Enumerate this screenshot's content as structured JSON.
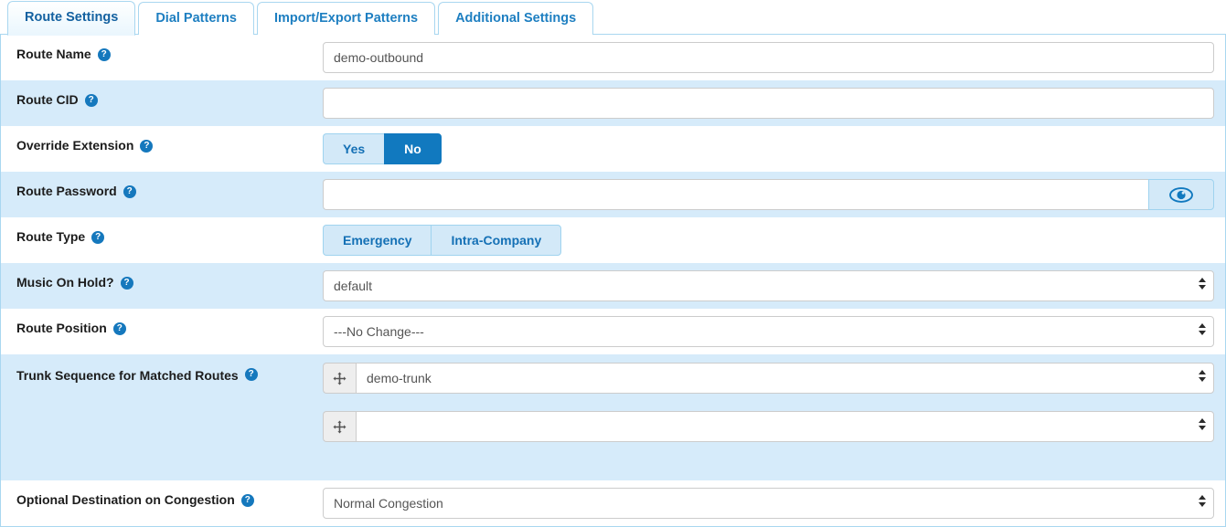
{
  "tabs": [
    {
      "label": "Route Settings",
      "active": true
    },
    {
      "label": "Dial Patterns",
      "active": false
    },
    {
      "label": "Import/Export Patterns",
      "active": false
    },
    {
      "label": "Additional Settings",
      "active": false
    }
  ],
  "help_glyph": "?",
  "colors": {
    "accent": "#1179bf",
    "tab_border": "#a9d7f0",
    "row_striped": "#d6ebfa",
    "button_inactive_bg": "#d3e9f8",
    "button_inactive_text": "#1470b5",
    "help_icon_bg": "#1578bd",
    "input_border": "#cccccc",
    "input_text": "#555555"
  },
  "fields": {
    "route_name": {
      "label": "Route Name",
      "value": "demo-outbound",
      "placeholder": ""
    },
    "route_cid": {
      "label": "Route CID",
      "value": "",
      "placeholder": ""
    },
    "override_extension": {
      "label": "Override Extension",
      "options": [
        "Yes",
        "No"
      ],
      "selected": "No"
    },
    "route_password": {
      "label": "Route Password",
      "value": "",
      "placeholder": "",
      "reveal_icon": "eye-icon"
    },
    "route_type": {
      "label": "Route Type",
      "options": [
        "Emergency",
        "Intra-Company"
      ],
      "selected": ""
    },
    "music_on_hold": {
      "label": "Music On Hold?",
      "value": "default"
    },
    "route_position": {
      "label": "Route Position",
      "value": "---No Change---"
    },
    "trunk_sequence": {
      "label": "Trunk Sequence for Matched Routes",
      "rows": [
        {
          "handle_icon": "drag-move-icon",
          "value": "demo-trunk"
        },
        {
          "handle_icon": "drag-move-icon",
          "value": ""
        }
      ]
    },
    "congestion_destination": {
      "label": "Optional Destination on Congestion",
      "value": "Normal Congestion"
    }
  }
}
